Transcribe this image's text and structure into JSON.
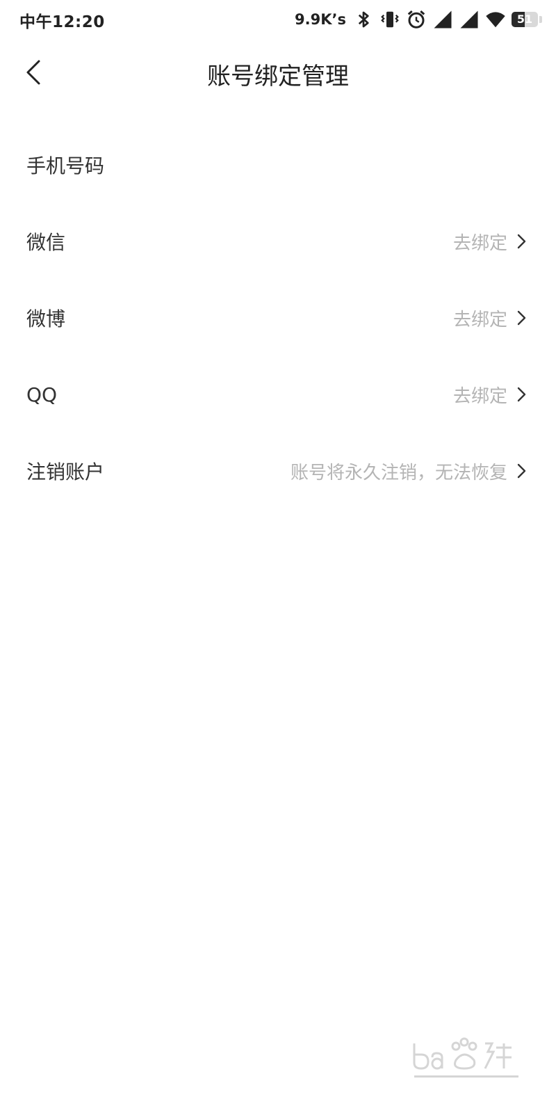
{
  "status_bar": {
    "time": "中午12:20",
    "net_speed": "9.9K’s",
    "battery_level": "51",
    "battery_fraction": 0.51,
    "icons": [
      "bluetooth-icon",
      "vibrate-icon",
      "alarm-icon",
      "signal-icon",
      "signal-icon",
      "wifi-icon",
      "battery-icon"
    ]
  },
  "header": {
    "title": "账号绑定管理",
    "back_icon": "back-arrow-icon"
  },
  "list": {
    "items": [
      {
        "label": "手机号码",
        "value": "",
        "has_chevron": false
      },
      {
        "label": "微信",
        "value": "去绑定",
        "has_chevron": true
      },
      {
        "label": "微博",
        "value": "去绑定",
        "has_chevron": true
      },
      {
        "label": "QQ",
        "value": "去绑定",
        "has_chevron": true
      },
      {
        "label": "注销账户",
        "value": "账号将永久注销，无法恢复",
        "has_chevron": true
      }
    ]
  },
  "colors": {
    "label": "#333333",
    "secondary": "#b4b4b4",
    "background": "#ffffff"
  }
}
